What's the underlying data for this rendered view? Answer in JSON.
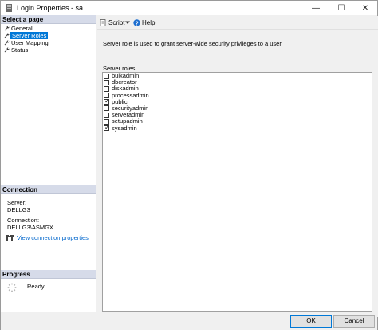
{
  "window": {
    "title": "Login Properties - sa",
    "controls": {
      "minimize": "—",
      "maximize": "☐",
      "close": "✕"
    }
  },
  "left_pane": {
    "select_page_header": "Select a page",
    "pages": [
      {
        "label": "General",
        "icon": "wrench-icon",
        "selected": false
      },
      {
        "label": "Server Roles",
        "icon": "wrench-icon",
        "selected": true
      },
      {
        "label": "User Mapping",
        "icon": "wrench-icon",
        "selected": false
      },
      {
        "label": "Status",
        "icon": "wrench-icon",
        "selected": false
      }
    ],
    "connection_header": "Connection",
    "server_label": "Server:",
    "server_value": "DELLG3",
    "connection_label": "Connection:",
    "connection_value": "DELLG3\\ASMGX",
    "view_link": "View connection properties",
    "progress_header": "Progress",
    "progress_status": "Ready"
  },
  "toolbar": {
    "script_label": "Script",
    "help_label": "Help"
  },
  "content": {
    "description": "Server role is used to grant server-wide security privileges to a user.",
    "roles_label": "Server roles:",
    "roles": [
      {
        "name": "bulkadmin",
        "checked": false
      },
      {
        "name": "dbcreator",
        "checked": false
      },
      {
        "name": "diskadmin",
        "checked": false
      },
      {
        "name": "processadmin",
        "checked": false
      },
      {
        "name": "public",
        "checked": true
      },
      {
        "name": "securityadmin",
        "checked": false
      },
      {
        "name": "serveradmin",
        "checked": false
      },
      {
        "name": "setupadmin",
        "checked": false
      },
      {
        "name": "sysadmin",
        "checked": true
      }
    ]
  },
  "buttons": {
    "ok": "OK",
    "cancel": "Cancel"
  },
  "colors": {
    "selection": "#0078d7",
    "header_bg": "#d6dbe9",
    "link": "#0066cc"
  }
}
